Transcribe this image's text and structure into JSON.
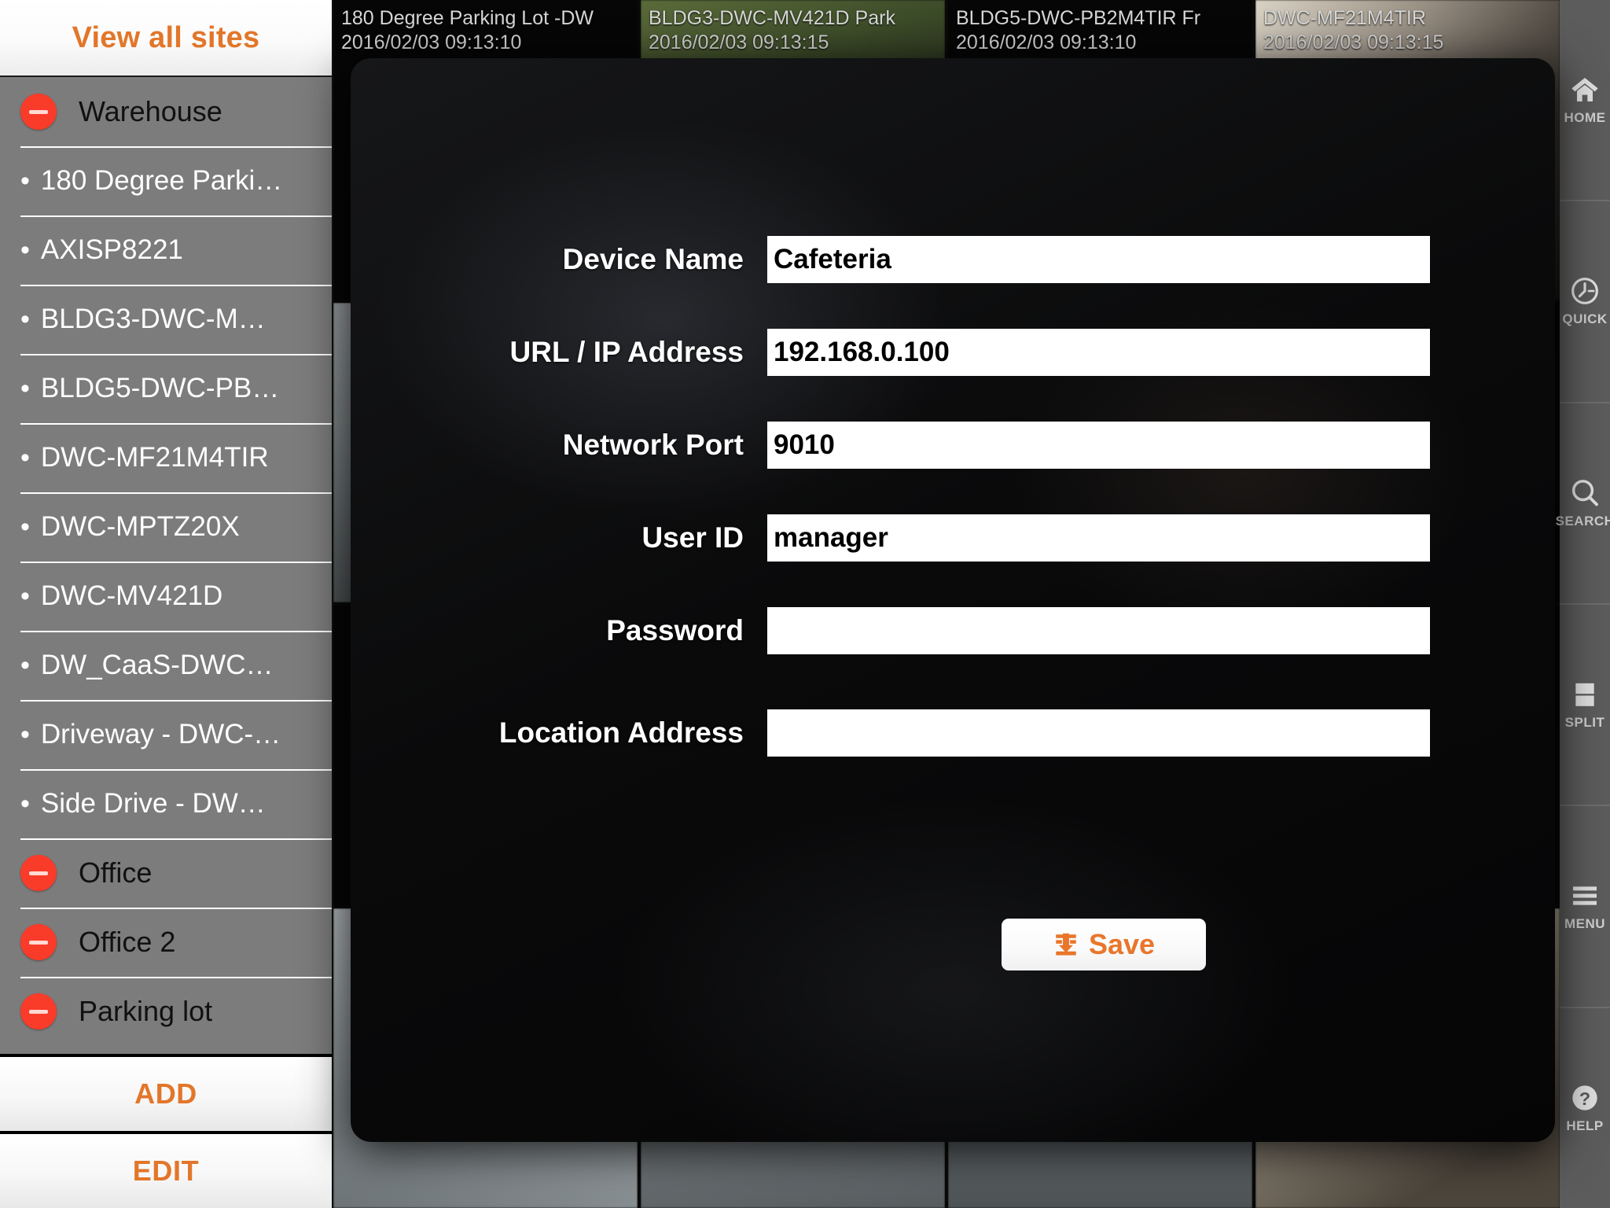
{
  "sidebar": {
    "header_label": "View all sites",
    "items": [
      {
        "type": "site",
        "label": "Warehouse",
        "icon": "minus-circle-icon"
      },
      {
        "type": "camera",
        "label": "180 Degree Parki…"
      },
      {
        "type": "camera",
        "label": "AXISP8221"
      },
      {
        "type": "camera",
        "label": "BLDG3-DWC-M…"
      },
      {
        "type": "camera",
        "label": "BLDG5-DWC-PB…"
      },
      {
        "type": "camera",
        "label": "DWC-MF21M4TIR"
      },
      {
        "type": "camera",
        "label": "DWC-MPTZ20X"
      },
      {
        "type": "camera",
        "label": "DWC-MV421D"
      },
      {
        "type": "camera",
        "label": "DW_CaaS-DWC…"
      },
      {
        "type": "camera",
        "label": "Driveway - DWC-…"
      },
      {
        "type": "camera",
        "label": "Side Drive - DW…"
      },
      {
        "type": "site",
        "label": "Office",
        "icon": "minus-circle-icon"
      },
      {
        "type": "site",
        "label": "Office 2",
        "icon": "minus-circle-icon"
      },
      {
        "type": "site",
        "label": "Parking lot",
        "icon": "minus-circle-icon"
      }
    ],
    "add_label": "ADD",
    "edit_label": "EDIT",
    "bullet": "•"
  },
  "video_wall": {
    "cells": [
      {
        "name": "180 Degree Parking Lot -DW",
        "timestamp": "2016/02/03 09:13:10",
        "scene": "sc-dark",
        "show_label": true
      },
      {
        "name": "BLDG3-DWC-MV421D Park",
        "timestamp": "2016/02/03 09:13:15",
        "scene": "sc-park",
        "show_label": true
      },
      {
        "name": "BLDG5-DWC-PB2M4TIR Fr",
        "timestamp": "2016/02/03 09:13:10",
        "scene": "sc-dark",
        "show_label": true
      },
      {
        "name": "DWC-MF21M4TIR",
        "timestamp": "2016/02/03 09:13:15",
        "scene": "sc-indoor2",
        "show_label": true
      },
      {
        "name": "",
        "timestamp": "",
        "scene": "sc-road",
        "show_label": false
      },
      {
        "name": "",
        "timestamp": "",
        "scene": "sc-dark",
        "show_label": false
      },
      {
        "name": "",
        "timestamp": "",
        "scene": "sc-dark",
        "show_label": false
      },
      {
        "name": "",
        "timestamp": "",
        "scene": "sc-dark",
        "show_label": false
      },
      {
        "name": "",
        "timestamp": "",
        "scene": "sc-dark",
        "show_label": false
      },
      {
        "name": "",
        "timestamp": "",
        "scene": "sc-dark",
        "show_label": false
      },
      {
        "name": "",
        "timestamp": "",
        "scene": "sc-dark",
        "show_label": false
      },
      {
        "name": "",
        "timestamp": "",
        "scene": "sc-dark",
        "show_label": false
      },
      {
        "name": "",
        "timestamp": "",
        "scene": "sc-roof",
        "show_label": false
      },
      {
        "name": "",
        "timestamp": "",
        "scene": "sc-lot",
        "show_label": false
      },
      {
        "name": "",
        "timestamp": "",
        "scene": "sc-road",
        "show_label": false
      },
      {
        "name": "",
        "timestamp": "",
        "scene": "sc-shop",
        "show_label": false
      }
    ]
  },
  "right_toolbar": {
    "items": [
      {
        "label": "HOME",
        "icon": "home-icon"
      },
      {
        "label": "QUICK",
        "icon": "clock-icon"
      },
      {
        "label": "SEARCH",
        "icon": "magnifier-icon"
      },
      {
        "label": "SPLIT",
        "icon": "split-layout-icon"
      },
      {
        "label": "MENU",
        "icon": "hamburger-icon"
      },
      {
        "label": "HELP",
        "icon": "question-circle-icon"
      }
    ]
  },
  "device_dialog": {
    "fields": [
      {
        "label": "Device Name",
        "value": "Cafeteria",
        "placeholder": "",
        "type": "text"
      },
      {
        "label": "URL / IP Address",
        "value": "192.168.0.100",
        "placeholder": "",
        "type": "text"
      },
      {
        "label": "Network Port",
        "value": "9010",
        "placeholder": "",
        "type": "text"
      },
      {
        "label": "User ID",
        "value": "manager",
        "placeholder": "",
        "type": "text"
      },
      {
        "label": "Password",
        "value": "",
        "placeholder": "",
        "type": "password"
      },
      {
        "label": "Location Address",
        "value": "",
        "placeholder": "",
        "type": "text"
      }
    ],
    "save_label": "Save",
    "save_icon": "save-download-icon"
  },
  "colors": {
    "accent_orange": "#e2762a",
    "minus_red": "#f93b29",
    "sidebar_grey": "#7c7c7c",
    "toolbar_grey": "#5c5c5c",
    "modal_black": "#0a0a0b",
    "field_white": "#ffffff"
  }
}
